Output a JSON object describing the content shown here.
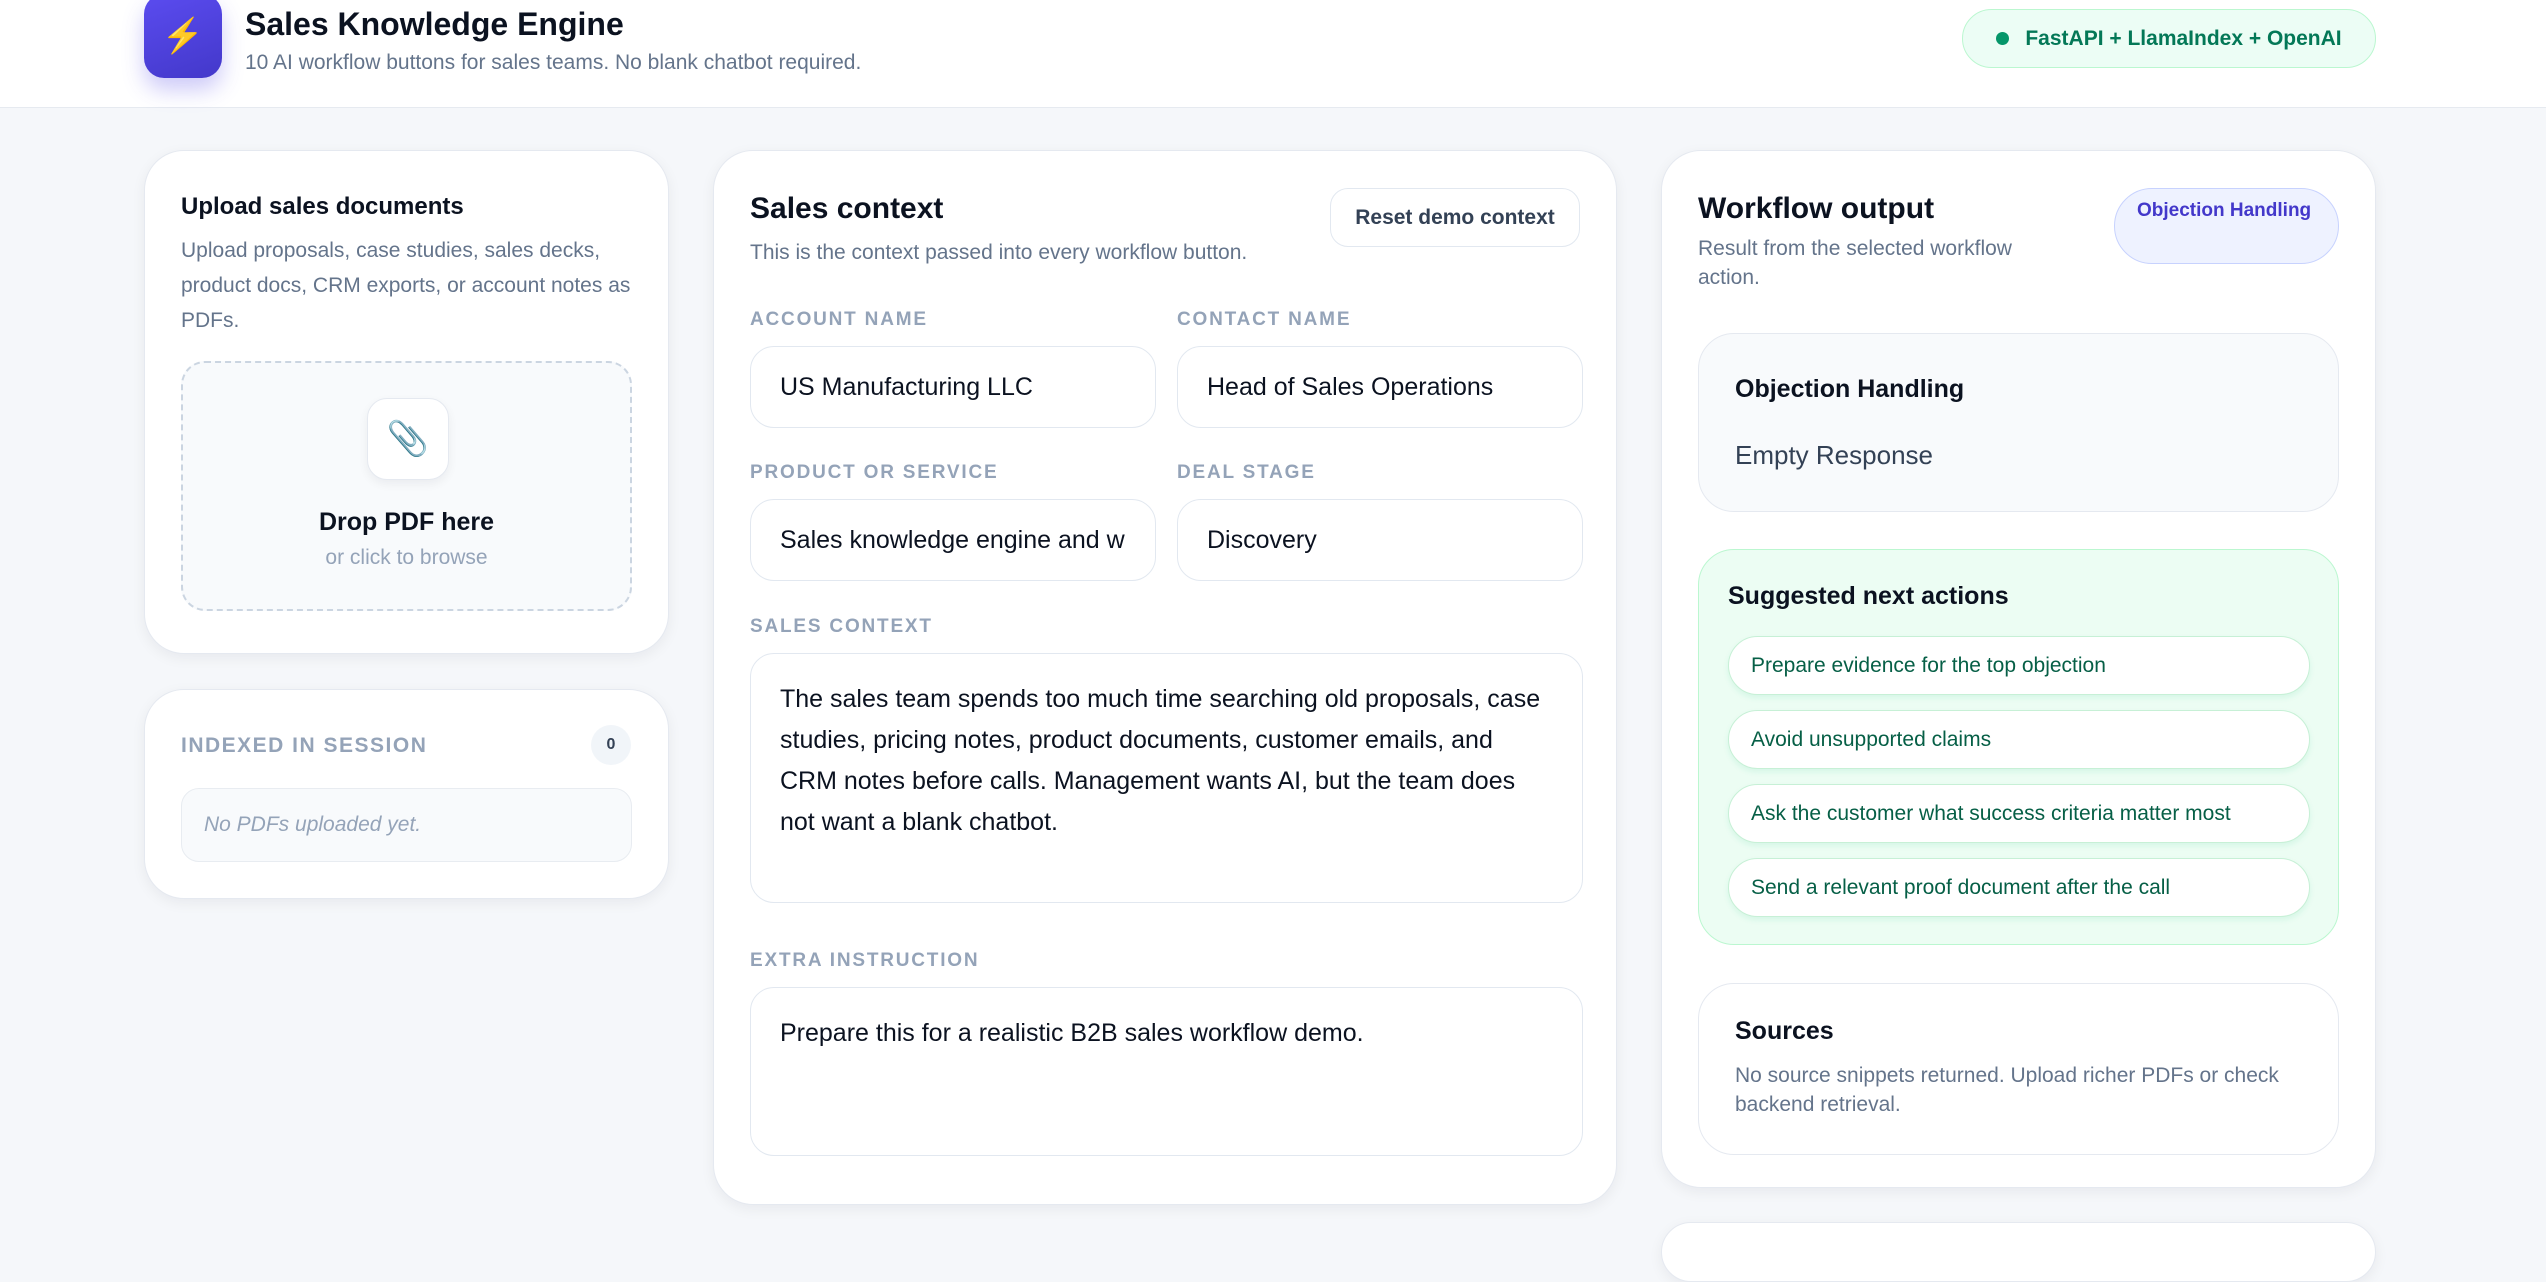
{
  "header": {
    "logo_icon": "lightning-icon",
    "title": "Sales Knowledge Engine",
    "subtitle": "10 AI workflow buttons for sales teams. No blank chatbot required.",
    "stack_badge": "FastAPI + LlamaIndex + OpenAI"
  },
  "upload": {
    "title": "Upload sales documents",
    "description": "Upload proposals, case studies, sales decks, product docs, CRM exports, or account notes as PDFs.",
    "drop_icon": "paperclip-icon",
    "drop_title": "Drop PDF here",
    "drop_sub": "or click to browse"
  },
  "indexed": {
    "label": "INDEXED IN SESSION",
    "count": "0",
    "empty": "No PDFs uploaded yet."
  },
  "context": {
    "title": "Sales context",
    "subtitle": "This is the context passed into every workflow button.",
    "reset_label": "Reset demo context",
    "account_label": "ACCOUNT NAME",
    "account_value": "US Manufacturing LLC",
    "contact_label": "CONTACT NAME",
    "contact_value": "Head of Sales Operations",
    "product_label": "PRODUCT OR SERVICE",
    "product_value": "Sales knowledge engine and w",
    "stage_label": "DEAL STAGE",
    "stage_value": "Discovery",
    "sales_context_label": "SALES CONTEXT",
    "sales_context_value": "The sales team spends too much time searching old proposals, case studies, pricing notes, product documents, customer emails, and CRM notes before calls. Management wants AI, but the team does not want a blank chatbot.",
    "extra_label": "EXTRA INSTRUCTION",
    "extra_value": "Prepare this for a realistic B2B sales workflow demo."
  },
  "output": {
    "title": "Workflow output",
    "subtitle": "Result from the selected workflow action.",
    "workflow_badge": "Objection Handling",
    "result_title": "Objection Handling",
    "result_body": "Empty Response",
    "actions_title": "Suggested next actions",
    "actions": [
      "Prepare evidence for the top objection",
      "Avoid unsupported claims",
      "Ask the customer what success criteria matter most",
      "Send a relevant proof document after the call"
    ],
    "sources_title": "Sources",
    "sources_body": "No source snippets returned. Upload richer PDFs or check backend retrieval."
  }
}
